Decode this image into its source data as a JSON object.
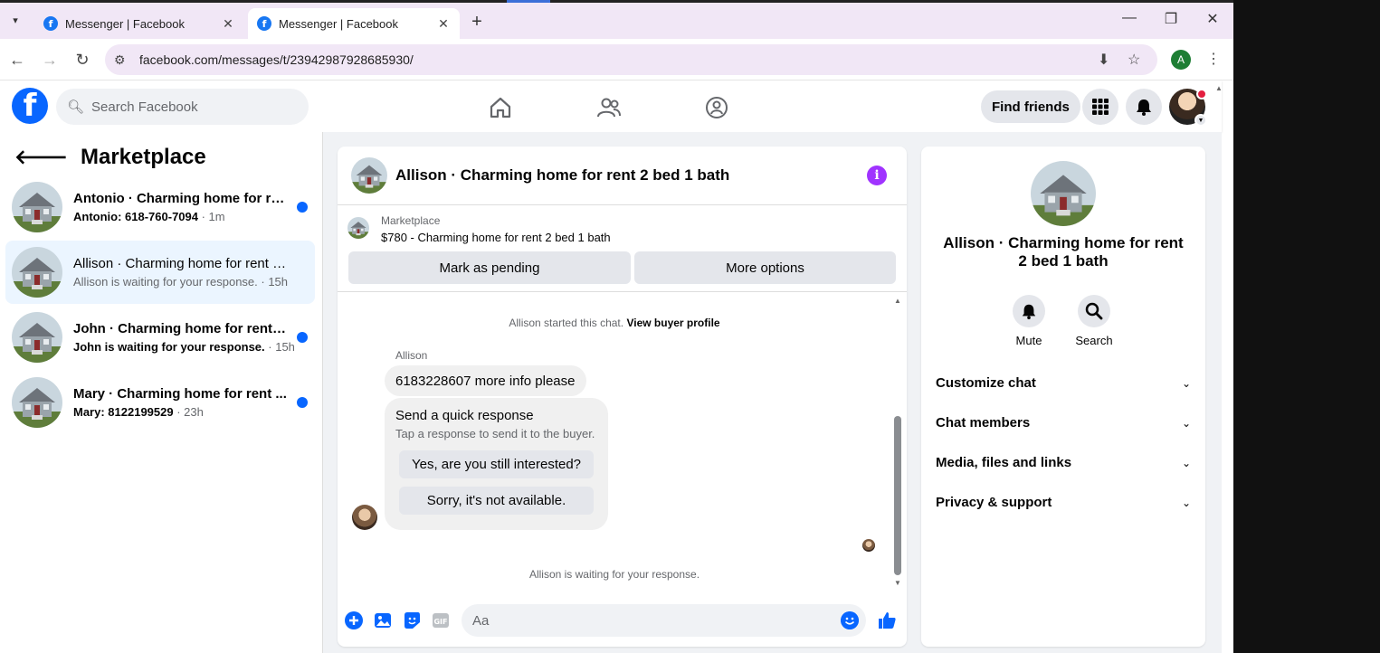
{
  "browser": {
    "tabs": [
      {
        "title": "Messenger | Facebook",
        "active": false
      },
      {
        "title": "Messenger | Facebook",
        "active": true
      }
    ],
    "url": "facebook.com/messages/t/23942987928685930/",
    "profile_letter": "A"
  },
  "header": {
    "search_placeholder": "Search Facebook",
    "find_friends": "Find friends"
  },
  "sidebar": {
    "title": "Marketplace",
    "conversations": [
      {
        "name": "Antonio · Charming home for re...",
        "preview": "Antonio: 618-760-7094",
        "time": " · 1m",
        "unread": true,
        "selected": false
      },
      {
        "name": "Allison · Charming home for rent 2...",
        "preview": "Allison is waiting for your response.",
        "time": " · 15h",
        "unread": false,
        "selected": true
      },
      {
        "name": "John · Charming home for rent 2...",
        "preview": "John is waiting for your response.",
        "time": " · 15h",
        "unread": true,
        "selected": false
      },
      {
        "name": "Mary · Charming home for rent ...",
        "preview": "Mary: 8122199529",
        "time": " · 23h",
        "unread": true,
        "selected": false
      }
    ]
  },
  "chat": {
    "title": "Allison · Charming home for rent 2 bed 1 bath",
    "listing": {
      "label": "Marketplace",
      "price_title": "$780 - Charming home for rent 2 bed 1 bath",
      "mark_pending": "Mark as pending",
      "more_options": "More options"
    },
    "started_text": "Allison started this chat.",
    "view_profile": "View buyer profile",
    "sender": "Allison",
    "message": "6183228607 more info please",
    "quick": {
      "heading": "Send a quick response",
      "sub": "Tap a response to send it to the buyer.",
      "options": [
        "Yes, are you still interested?",
        "Sorry, it's not available."
      ]
    },
    "waiting": "Allison is waiting for your response.",
    "composer_placeholder": "Aa"
  },
  "info": {
    "title": "Allison · Charming home for rent 2 bed 1 bath",
    "actions": [
      {
        "label": "Mute",
        "icon": "bell-icon"
      },
      {
        "label": "Search",
        "icon": "search-icon"
      }
    ],
    "sections": [
      "Customize chat",
      "Chat members",
      "Media, files and links",
      "Privacy & support"
    ]
  },
  "colors": {
    "brand": "#0866ff",
    "selected_bg": "#ebf5ff",
    "info_purple": "#a033ff"
  }
}
